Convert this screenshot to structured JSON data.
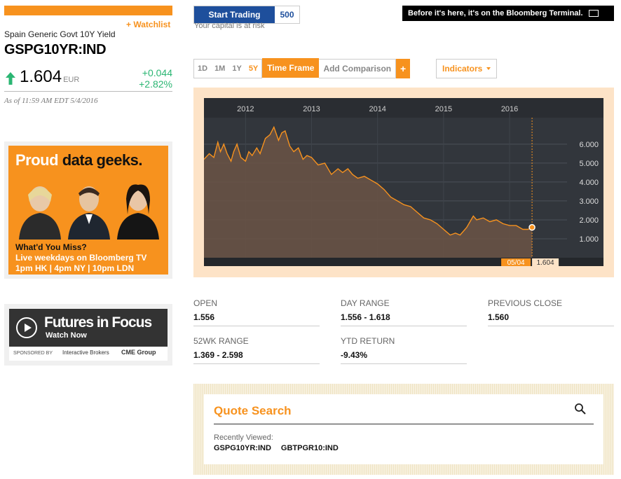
{
  "security": {
    "watchlist_label": "+ Watchlist",
    "name": "Spain Generic Govt 10Y Yield",
    "ticker": "GSPG10YR:IND",
    "price": "1.604",
    "currency": "EUR",
    "change": "+0.044",
    "change_pct": "+2.82%",
    "as_of": "As of 11:59 AM EDT 5/4/2016"
  },
  "ads": {
    "tv": {
      "headline_a": "Proud",
      "headline_b": "data geeks.",
      "line1": "What'd You Miss?",
      "line2": "Live weekdays on Bloomberg TV",
      "line3": "1pm HK | 4pm NY | 10pm LDN"
    },
    "futures": {
      "title": "Futures in Focus",
      "watch": "Watch Now",
      "sponsored": "SPONSORED BY",
      "sponsor1": "Interactive Brokers",
      "sponsor2": "CME Group"
    },
    "trade_button": "Start Trading",
    "trade_logo": "500",
    "risk_notice": "Your capital is at risk",
    "terminal_banner": "Before it's here, it's on the Bloomberg Terminal."
  },
  "toolbar": {
    "timeframes": [
      "1D",
      "1M",
      "1Y",
      "5Y"
    ],
    "active_timeframe": "5Y",
    "time_frame_label": "Time Frame",
    "add_comparison": "Add Comparison",
    "plus": "+",
    "indicators": "Indicators"
  },
  "chart_data": {
    "type": "area",
    "x_tick_labels": [
      "2012",
      "2013",
      "2014",
      "2015",
      "2016"
    ],
    "y_tick_labels": [
      "6.000",
      "5.000",
      "4.000",
      "3.000",
      "2.000",
      "1.000"
    ],
    "y_ticks": [
      6,
      5,
      4,
      3,
      2,
      1
    ],
    "ylim": [
      0,
      7.4
    ],
    "xlim": [
      2011.37,
      2016.87
    ],
    "x_ticks": [
      2012,
      2013,
      2014,
      2015,
      2016
    ],
    "x": [
      2011.37,
      2011.45,
      2011.52,
      2011.58,
      2011.62,
      2011.67,
      2011.72,
      2011.78,
      2011.82,
      2011.87,
      2011.93,
      2012.0,
      2012.05,
      2012.1,
      2012.17,
      2012.22,
      2012.3,
      2012.37,
      2012.43,
      2012.5,
      2012.55,
      2012.6,
      2012.67,
      2012.73,
      2012.8,
      2012.87,
      2012.93,
      2013.0,
      2013.1,
      2013.2,
      2013.3,
      2013.4,
      2013.47,
      2013.55,
      2013.62,
      2013.7,
      2013.8,
      2013.9,
      2014.0,
      2014.1,
      2014.2,
      2014.3,
      2014.4,
      2014.5,
      2014.6,
      2014.7,
      2014.8,
      2014.9,
      2015.0,
      2015.1,
      2015.18,
      2015.25,
      2015.35,
      2015.45,
      2015.5,
      2015.6,
      2015.7,
      2015.8,
      2015.9,
      2016.0,
      2016.1,
      2016.2,
      2016.28,
      2016.34
    ],
    "values": [
      5.2,
      5.5,
      5.3,
      6.1,
      5.6,
      6.0,
      5.5,
      5.1,
      5.6,
      6.0,
      5.3,
      5.1,
      5.6,
      5.4,
      5.8,
      5.5,
      6.3,
      6.5,
      6.9,
      6.2,
      6.6,
      6.7,
      5.9,
      5.6,
      5.8,
      5.2,
      5.4,
      5.3,
      4.9,
      5.0,
      4.4,
      4.7,
      4.5,
      4.7,
      4.4,
      4.2,
      4.3,
      4.1,
      3.9,
      3.6,
      3.2,
      3.0,
      2.8,
      2.7,
      2.4,
      2.1,
      2.0,
      1.8,
      1.5,
      1.2,
      1.3,
      1.2,
      1.6,
      2.2,
      2.0,
      2.1,
      1.9,
      2.0,
      1.8,
      1.7,
      1.7,
      1.5,
      1.5,
      1.604
    ],
    "last_date_label": "05/04",
    "last_value_label": "1.604"
  },
  "stats": [
    {
      "label": "OPEN",
      "value": "1.556"
    },
    {
      "label": "DAY RANGE",
      "value": "1.556 - 1.618"
    },
    {
      "label": "PREVIOUS CLOSE",
      "value": "1.560"
    },
    {
      "label": "52WK RANGE",
      "value": "1.369 - 2.598"
    },
    {
      "label": "YTD RETURN",
      "value": "-9.43%"
    }
  ],
  "quote_search": {
    "title": "Quote Search",
    "recently_viewed_label": "Recently Viewed:",
    "recent": [
      "GSPG10YR:IND",
      "GBTPGR10:IND"
    ]
  },
  "colors": {
    "accent": "#f7921e",
    "positive": "#2bb673",
    "chart_bg": "#32363c"
  }
}
